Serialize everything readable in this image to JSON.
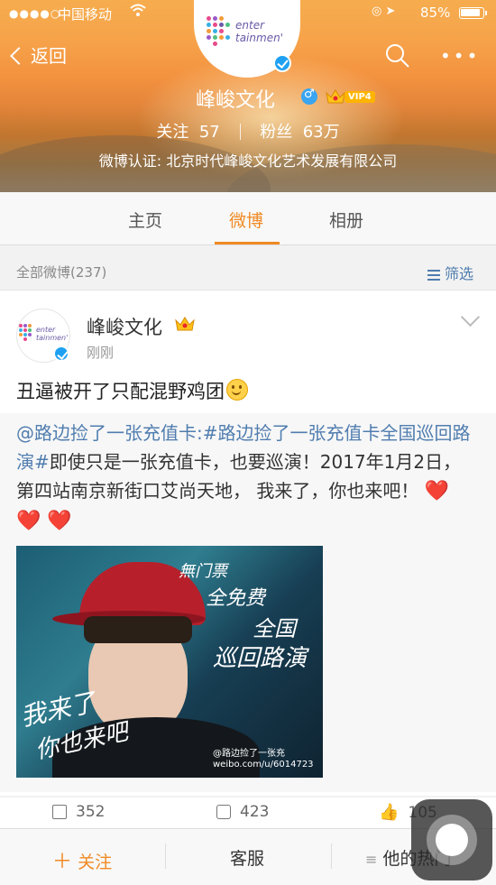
{
  "status": {
    "carrier": "中国移动",
    "battery": "85%"
  },
  "header": {
    "back": "返回",
    "logo_line1": "enter",
    "logo_line2": "tainmen'",
    "name": "峰峻文化",
    "vip": "VIP4",
    "follow_label": "关注",
    "follow_count": "57",
    "fans_label": "粉丝",
    "fans_count": "63万",
    "verify": "微博认证: 北京时代峰峻文化艺术发展有限公司"
  },
  "tabs": [
    "主页",
    "微博",
    "相册"
  ],
  "filter": {
    "count": "全部微博(237)",
    "label": "筛选"
  },
  "post": {
    "author": "峰峻文化",
    "time": "刚刚",
    "text": "丑逼被开了只配混野鸡团",
    "repost_link1": "@路边捡了一张充值卡",
    "repost_link2": ":#路边捡了一张充值卡全国巡回路演#",
    "repost_text": "即使只是一张充值卡，也要巡演！2017年1月2日，第四站南京新街口艾尚天地， 我来了，你也来吧！",
    "hearts": "❤️ ❤️ ❤️",
    "photo_text1": "無门票",
    "photo_text2": "全免费",
    "photo_text3": "全国",
    "photo_text4": "巡回路演",
    "photo_text5": "我来了",
    "photo_text6": "你也来吧",
    "photo_wm1": "@路边捡了一张充",
    "photo_wm2": "weibo.com/u/6014723"
  },
  "actions": {
    "repost": "352",
    "comment": "423",
    "like": "105"
  },
  "bottom": {
    "follow": "关注",
    "service": "客服",
    "hot": "他的热门"
  }
}
